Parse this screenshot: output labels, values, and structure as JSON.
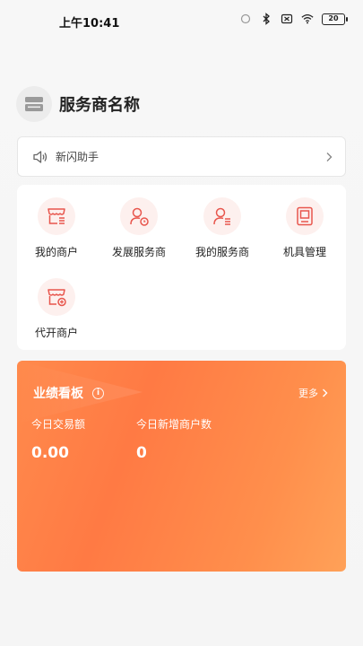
{
  "status_bar": {
    "time": "上午10:41",
    "battery": "20"
  },
  "header": {
    "provider_name": "服务商名称"
  },
  "notice": {
    "text": "新闪助手"
  },
  "menu": {
    "items": [
      {
        "label": "我的商户",
        "icon": "store-list-icon"
      },
      {
        "label": "发展服务商",
        "icon": "user-add-icon"
      },
      {
        "label": "我的服务商",
        "icon": "user-list-icon"
      },
      {
        "label": "机具管理",
        "icon": "pos-terminal-icon"
      },
      {
        "label": "代开商户",
        "icon": "store-add-icon"
      }
    ]
  },
  "board": {
    "title": "业绩看板",
    "more": "更多",
    "stats": [
      {
        "label": "今日交易额",
        "value": "0.00"
      },
      {
        "label": "今日新增商户数",
        "value": "0"
      }
    ]
  },
  "colors": {
    "accent": "#e8564d",
    "board_gradient_start": "#ff7a44",
    "board_gradient_end": "#ffa158"
  }
}
